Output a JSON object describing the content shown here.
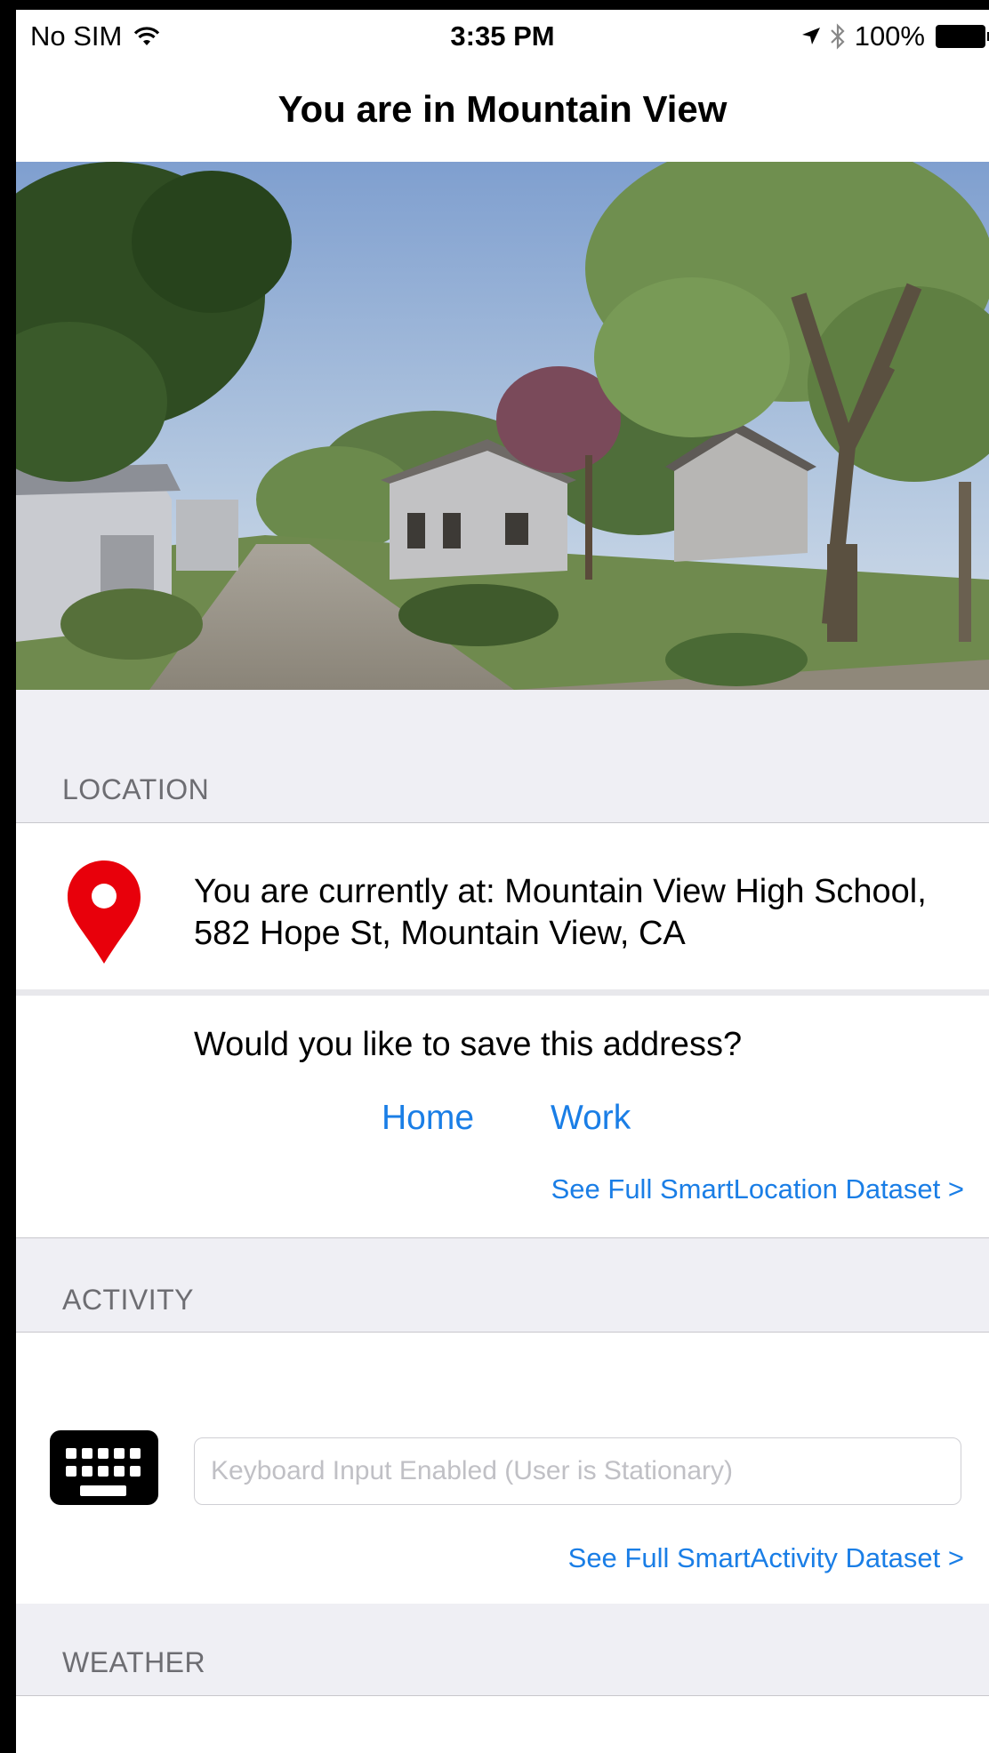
{
  "status_bar": {
    "carrier": "No SIM",
    "time": "3:35 PM",
    "battery": "100%"
  },
  "nav": {
    "title": "You are in Mountain View"
  },
  "location": {
    "header": "LOCATION",
    "current_text": "You are currently at: Mountain View High School, 582 Hope St, Mountain View, CA",
    "save_prompt": "Would you like to save this address?",
    "home_label": "Home",
    "work_label": "Work",
    "dataset_link": "See Full SmartLocation Dataset >"
  },
  "activity": {
    "header": "ACTIVITY",
    "input_placeholder": "Keyboard Input Enabled (User is Stationary)",
    "input_value": "",
    "dataset_link": "See Full SmartActivity Dataset >"
  },
  "weather": {
    "header": "WEATHER"
  },
  "colors": {
    "accent": "#1a7ee6",
    "pin": "#e8000b",
    "group_bg": "#efeff4"
  }
}
